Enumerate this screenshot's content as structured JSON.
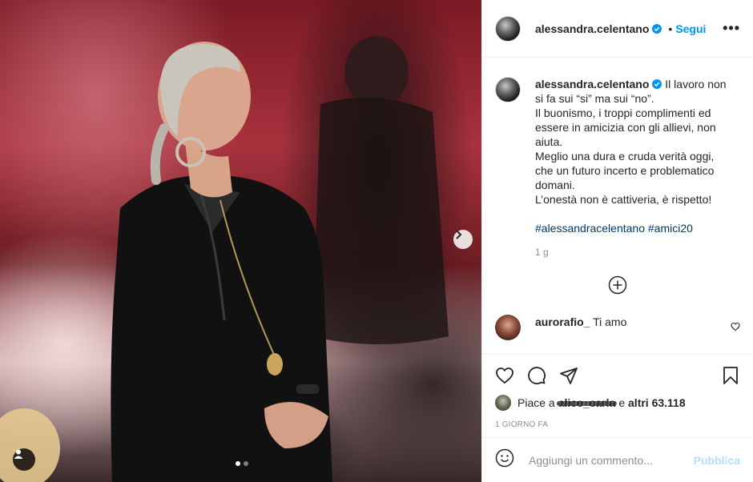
{
  "post": {
    "username": "alessandra.celentano",
    "bullet": "•",
    "follow_label": "Segui",
    "more_label": "•••",
    "caption_lines": [
      "Il lavoro non si fa sui “si” ma sui “no”.",
      "Il buonismo, i troppi complimenti ed essere in amicizia con gli allievi, non aiuta.",
      "Meglio una dura e cruda verità oggi, che un futuro incerto e problematico domani.",
      "L’onestà non è cattiveria, è rispetto!"
    ],
    "hashtags": "#alessandracelentano #amici20",
    "caption_time": "1 g",
    "comments": [
      {
        "username": "aurorafio_",
        "text": "Ti amo"
      }
    ],
    "likes": {
      "prefix": "Piace a",
      "liker": "alice_carla",
      "suffix_connector": "e",
      "others": "altri 63.118"
    },
    "timestamp": "1 GIORNO FA",
    "comment_placeholder": "Aggiungi un commento...",
    "publish_label": "Pubblica"
  },
  "carousel": {
    "total": 2,
    "current": 1
  },
  "colors": {
    "accent": "#0095f6",
    "publish_disabled": "#b2dffc",
    "hashtag": "#00376b",
    "muted": "#8e8e8e"
  },
  "icons": [
    "verified-badge-icon",
    "more-options-icon",
    "add-circle-icon",
    "heart-icon",
    "comment-icon",
    "share-icon",
    "bookmark-icon",
    "emoji-icon",
    "user-tag-icon",
    "chevron-right-icon"
  ]
}
